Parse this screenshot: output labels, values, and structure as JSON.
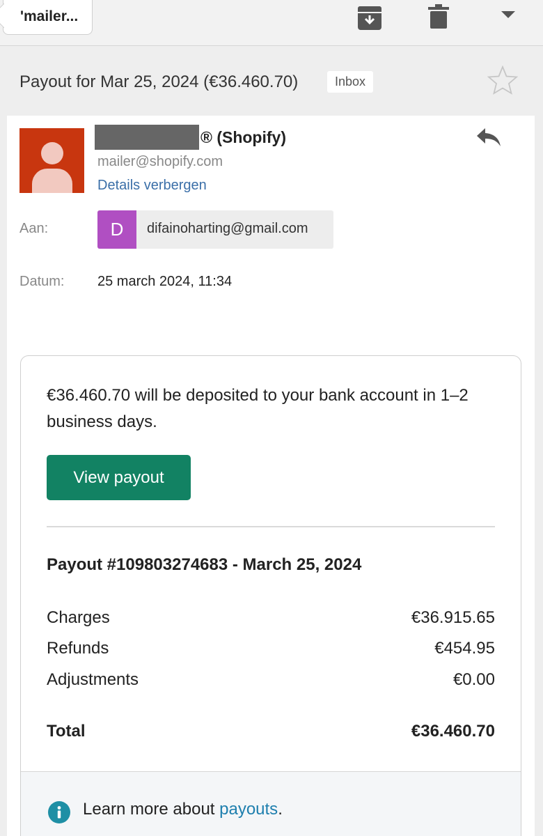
{
  "toolbar": {
    "back_label": "'mailer...",
    "icons": [
      "archive-icon",
      "trash-icon",
      "caret-down-icon"
    ]
  },
  "subject": {
    "title": "Payout for Mar 25, 2024 (€36.460.70)",
    "badge": "Inbox"
  },
  "sender": {
    "name": "® (Shopify)",
    "email": "mailer@shopify.com",
    "details_link": "Details verbergen"
  },
  "recipient": {
    "label": "Aan:",
    "initial": "D",
    "email": "difainoharting@gmail.com"
  },
  "date": {
    "label": "Datum:",
    "value": "25 march 2024, 11:34"
  },
  "body": {
    "deposit_text": "€36.460.70 will be deposited to your bank account in 1–2 business days.",
    "view_button": "View payout",
    "payout_title": "Payout #109803274683 - March 25, 2024",
    "rows": [
      {
        "label": "Charges",
        "value": "€36.915.65"
      },
      {
        "label": "Refunds",
        "value": "€454.95"
      },
      {
        "label": "Adjustments",
        "value": "€0.00"
      }
    ],
    "total": {
      "label": "Total",
      "value": "€36.460.70"
    },
    "learn_prefix": "Learn more about ",
    "learn_link": "payouts",
    "learn_suffix": "."
  },
  "colors": {
    "avatar": "#c8360f",
    "chip_avatar": "#b04fc2",
    "button": "#128263",
    "link": "#3b6fa8",
    "info": "#1e8fa5"
  }
}
